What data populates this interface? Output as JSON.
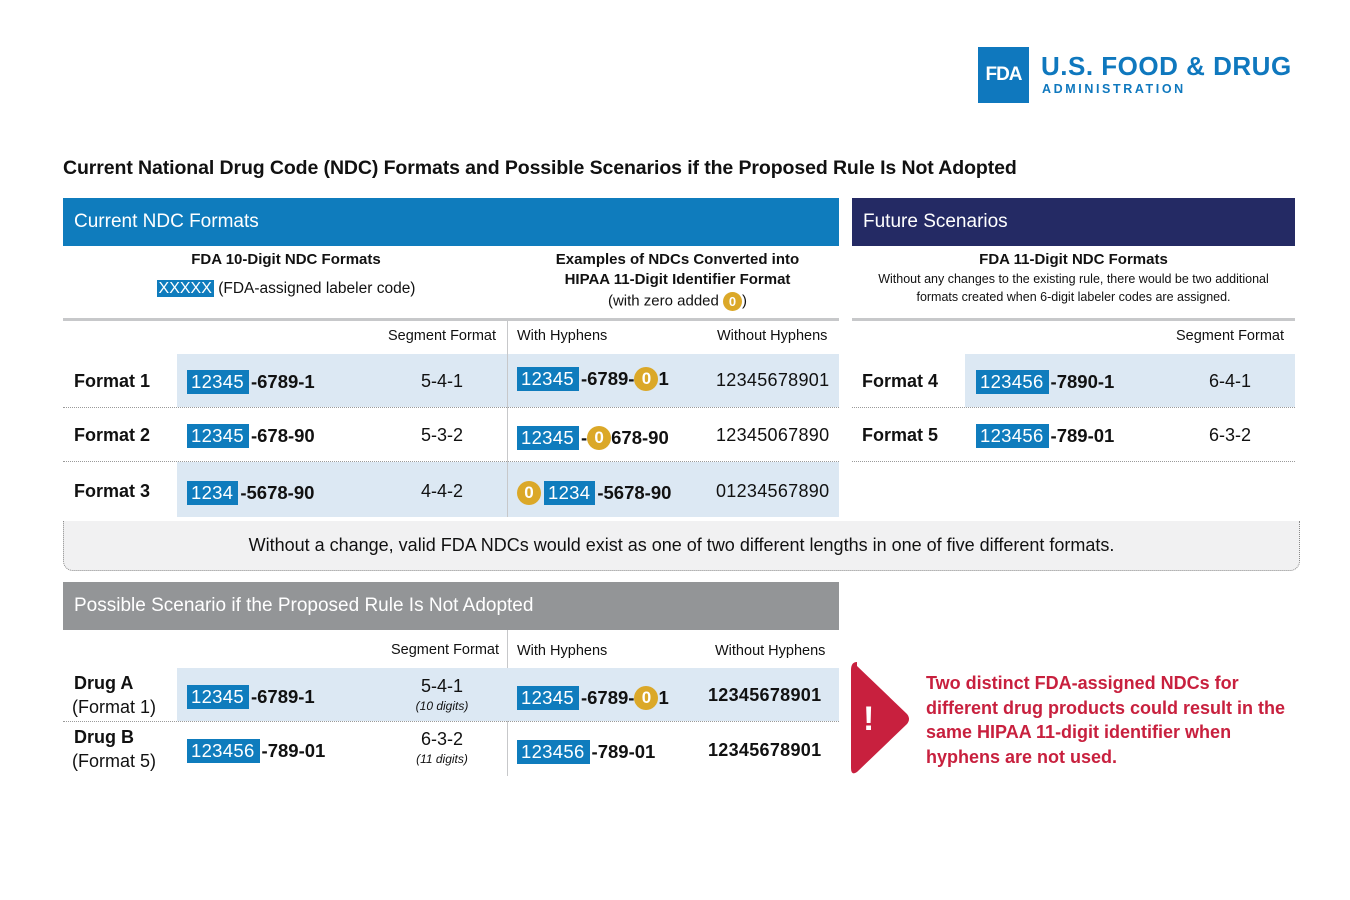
{
  "logo": {
    "mark": "FDA",
    "title": "U.S. FOOD & DRUG",
    "subtitle": "ADMINISTRATION",
    "brand_color": "#0f78be"
  },
  "title": "Current National Drug Code (NDC) Formats and Possible Scenarios if the Proposed Rule Is Not Adopted",
  "colors": {
    "current_bar": "#0f7cbd",
    "future_bar": "#242a64",
    "possible_bar": "#939597",
    "labeler_highlight": "#0f7cbd",
    "zero_marker": "#dba828",
    "row_highlight": "#dce8f3",
    "warning": "#c8203e"
  },
  "current": {
    "header": "Current NDC Formats",
    "left_subhead": "FDA 10-Digit NDC Formats",
    "legend_code": "XXXXX",
    "legend_text": "(FDA-assigned labeler code)",
    "right_subhead_line1": "Examples of NDCs Converted into",
    "right_subhead_line2": "HIPAA 11-Digit Identifier Format",
    "right_note_prefix": "(with zero added ",
    "right_note_zero": "0",
    "right_note_suffix": ")",
    "col_segment": "Segment Format",
    "col_with_hyphens": "With Hyphens",
    "col_without_hyphens": "Without Hyphens",
    "rows": [
      {
        "label": "Format 1",
        "labeler": "12345",
        "rest": "-6789-1",
        "segment": "5-4-1",
        "hipaa": {
          "lead_zero": "",
          "labeler": "12345",
          "mid": "-6789-",
          "zero": "0",
          "tail": "1"
        },
        "without": "12345678901"
      },
      {
        "label": "Format 2",
        "labeler": "12345",
        "rest": "-678-90",
        "segment": "5-3-2",
        "hipaa": {
          "lead_zero": "",
          "labeler": "12345",
          "mid": "-",
          "zero": "0",
          "tail": "678-90"
        },
        "without": "12345067890"
      },
      {
        "label": "Format 3",
        "labeler": "1234",
        "rest": "-5678-90",
        "segment": "4-4-2",
        "hipaa": {
          "lead_zero": "0",
          "labeler": "1234",
          "mid": "-5678-90",
          "zero": "",
          "tail": ""
        },
        "without": "01234567890"
      }
    ]
  },
  "future": {
    "header": "Future Scenarios",
    "subhead": "FDA 11-Digit NDC Formats",
    "note_line1": "Without any changes to the existing rule, there would be two additional",
    "note_line2": "formats created when 6-digit labeler codes are assigned.",
    "col_segment": "Segment Format",
    "rows": [
      {
        "label": "Format 4",
        "labeler": "123456",
        "rest": "-7890-1",
        "segment": "6-4-1"
      },
      {
        "label": "Format 5",
        "labeler": "123456",
        "rest": "-789-01",
        "segment": "6-3-2"
      }
    ]
  },
  "summary": "Without a change, valid FDA NDCs would exist as one of two different lengths in one of five different formats.",
  "possible": {
    "header": "Possible Scenario if the Proposed Rule Is Not Adopted",
    "col_segment": "Segment Format",
    "col_with_hyphens": "With Hyphens",
    "col_without_hyphens": "Without Hyphens",
    "rows": [
      {
        "label": "Drug A",
        "sublabel": "(Format 1)",
        "labeler": "12345",
        "rest": "-6789-1",
        "segment": "5-4-1",
        "digits": "(10 digits)",
        "hipaa": {
          "labeler": "12345",
          "mid": "-6789-",
          "zero": "0",
          "tail": "1"
        },
        "without": "12345678901"
      },
      {
        "label": "Drug B",
        "sublabel": "(Format 5)",
        "labeler": "123456",
        "rest": "-789-01",
        "segment": "6-3-2",
        "digits": "(11 digits)",
        "hipaa": {
          "labeler": "123456",
          "mid": "-789-01",
          "zero": "",
          "tail": ""
        },
        "without": "12345678901"
      }
    ]
  },
  "warning": {
    "icon": "exclamation-icon",
    "symbol": "!",
    "text": "Two distinct FDA-assigned NDCs for different drug products could result in the same HIPAA 11-digit identifier when hyphens are not used."
  }
}
